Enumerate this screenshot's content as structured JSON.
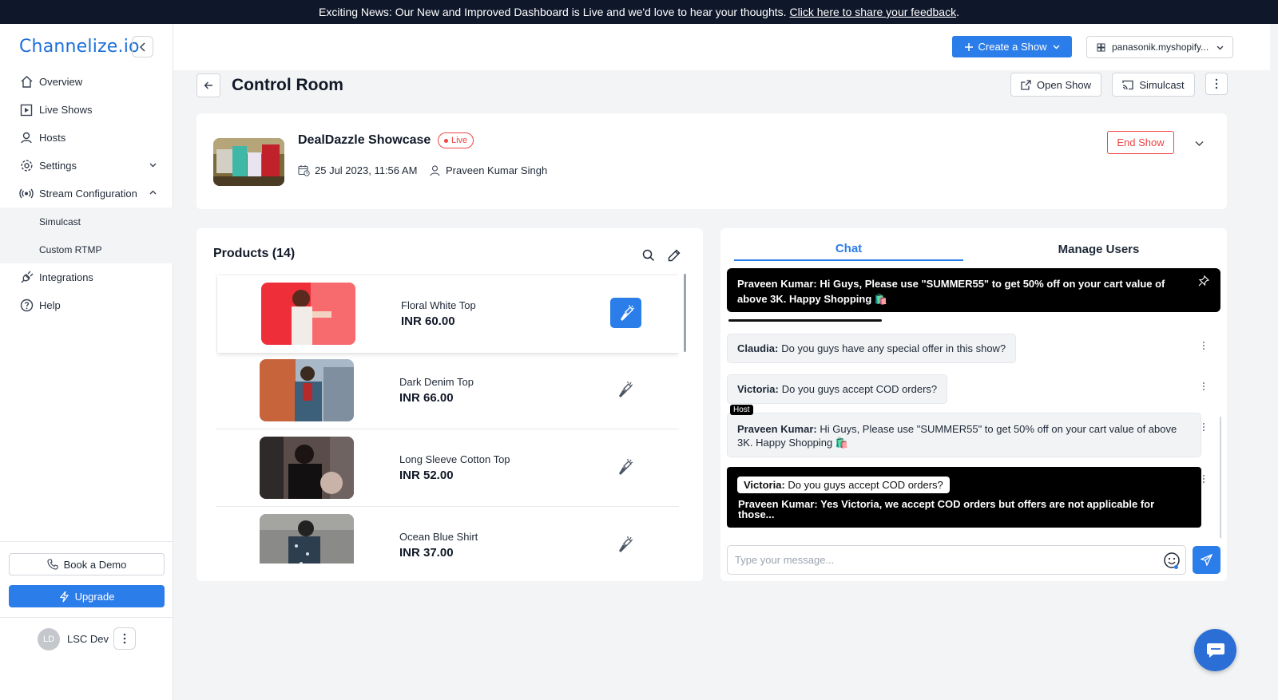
{
  "banner": {
    "text": "Exciting News: Our New and Improved Dashboard is Live and we'd love to hear your thoughts.",
    "link": "Click here to share your feedback",
    "suffix": "."
  },
  "brand": {
    "logo_text": "Channelize.io",
    "color": "#1d6fd8"
  },
  "sidebar": {
    "items": [
      {
        "label": "Overview",
        "icon": "home-icon"
      },
      {
        "label": "Live Shows",
        "icon": "play-square-icon"
      },
      {
        "label": "Hosts",
        "icon": "user-icon"
      },
      {
        "label": "Settings",
        "icon": "gear-icon"
      },
      {
        "label": "Stream Configuration",
        "icon": "broadcast-icon"
      },
      {
        "label": "Integrations",
        "icon": "plug-icon"
      },
      {
        "label": "Help",
        "icon": "help-icon"
      }
    ],
    "sub_items": [
      "Simulcast",
      "Custom RTMP"
    ],
    "book_demo": "Book a Demo",
    "upgrade": "Upgrade",
    "user_initials": "LD",
    "user_name": "LSC Dev"
  },
  "header": {
    "create_show": "Create a Show",
    "store": "panasonik.myshopify..."
  },
  "page": {
    "title": "Control Room",
    "open_show": "Open Show",
    "simulcast": "Simulcast"
  },
  "show": {
    "title": "DealDazzle Showcase",
    "status": "Live",
    "datetime": "25 Jul 2023, 11:56 AM",
    "host": "Praveen Kumar Singh",
    "end_show": "End Show"
  },
  "products": {
    "title": "Products (14)",
    "items": [
      {
        "name": "Floral White Top",
        "price": "INR 60.00",
        "spotlight": true
      },
      {
        "name": "Dark Denim Top",
        "price": "INR 66.00",
        "spotlight": false
      },
      {
        "name": "Long Sleeve Cotton Top",
        "price": "INR 52.00",
        "spotlight": false
      },
      {
        "name": "Ocean Blue Shirt",
        "price": "INR 37.00",
        "spotlight": false
      }
    ]
  },
  "chat": {
    "tabs": [
      "Chat",
      "Manage Users"
    ],
    "pinned": {
      "author": "Praveen Kumar:",
      "text": "Hi Guys, Please use \"SUMMER55\" to get 50% off on your cart value of above 3K. Happy Shopping 🛍️"
    },
    "messages": [
      {
        "author": "Claudia:",
        "text": "Do you guys have any special offer in this show?"
      },
      {
        "author": "Victoria:",
        "text": "Do you guys accept COD orders?"
      }
    ],
    "host_tag": "Host",
    "host_message": {
      "author": "Praveen Kumar:",
      "text": "Hi Guys, Please use \"SUMMER55\" to get 50% off on your cart value of above 3K. Happy Shopping 🛍️"
    },
    "reply": {
      "quote_author": "Victoria:",
      "quote_text": "Do you guys accept COD orders?",
      "author": "Praveen Kumar:",
      "text": "Yes Victoria, we accept COD orders but offers are not applicable for those..."
    },
    "input_placeholder": "Type your message..."
  },
  "colors": {
    "accent": "#2b7de9",
    "danger": "#ef4444",
    "banner_bg": "#0f172a"
  }
}
